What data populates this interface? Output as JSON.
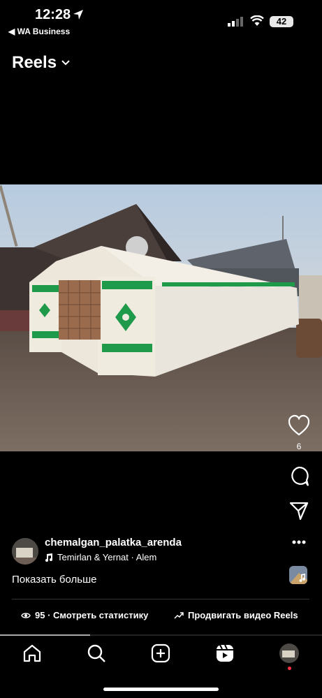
{
  "status": {
    "time": "12:28",
    "back_app": "◀ WA Business",
    "battery": "42"
  },
  "header": {
    "title": "Reels"
  },
  "post": {
    "likes": "6",
    "username": "chemalgan_palatka_arenda",
    "music": "Temirlan & Yernat · Alem",
    "caption": "Показать больше",
    "views": "95 · Смотреть статистику",
    "boost": "Продвигать видео Reels"
  },
  "video_progress": 0.28,
  "colors": {
    "background": "#000000",
    "tent": "#ece7da",
    "ornament": "#1f9a4a",
    "notification_dot": "#ff3040"
  },
  "icons": [
    "location-arrow-icon",
    "signal-icon",
    "wifi-icon",
    "chevron-down-icon",
    "heart-icon",
    "comment-icon",
    "share-icon",
    "more-icon",
    "music-note-icon",
    "eye-icon",
    "trend-arrow-icon",
    "home-icon",
    "search-icon",
    "create-icon",
    "reels-icon",
    "profile-avatar"
  ]
}
